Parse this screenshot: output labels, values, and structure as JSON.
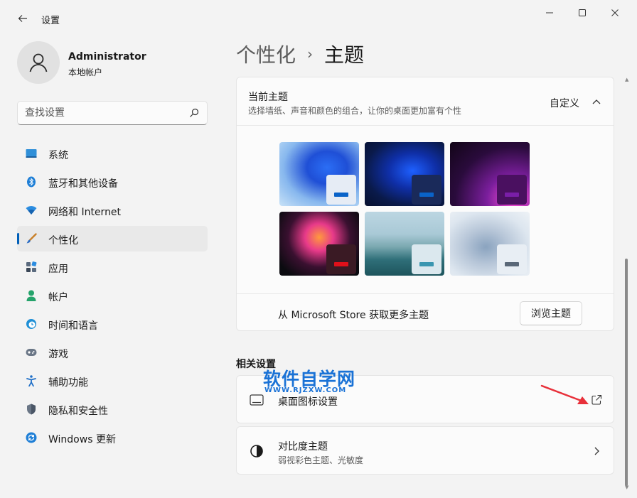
{
  "window": {
    "title": "设置",
    "back_icon": "back-arrow-icon",
    "controls": [
      "minimize-icon",
      "maximize-icon",
      "close-icon"
    ]
  },
  "profile": {
    "name": "Administrator",
    "account_type": "本地帐户"
  },
  "search": {
    "placeholder": "查找设置",
    "value": ""
  },
  "sidebar": {
    "items": [
      {
        "label": "系统",
        "icon": "system-icon",
        "active": false
      },
      {
        "label": "蓝牙和其他设备",
        "icon": "bluetooth-icon",
        "active": false
      },
      {
        "label": "网络和 Internet",
        "icon": "network-icon",
        "active": false
      },
      {
        "label": "个性化",
        "icon": "personalization-icon",
        "active": true
      },
      {
        "label": "应用",
        "icon": "apps-icon",
        "active": false
      },
      {
        "label": "帐户",
        "icon": "account-icon",
        "active": false
      },
      {
        "label": "时间和语言",
        "icon": "time-language-icon",
        "active": false
      },
      {
        "label": "游戏",
        "icon": "gaming-icon",
        "active": false
      },
      {
        "label": "辅助功能",
        "icon": "accessibility-icon",
        "active": false
      },
      {
        "label": "隐私和安全性",
        "icon": "privacy-icon",
        "active": false
      },
      {
        "label": "Windows 更新",
        "icon": "windows-update-icon",
        "active": false
      }
    ]
  },
  "breadcrumb": {
    "parent": "个性化",
    "separator": "›",
    "current": "主题"
  },
  "current_theme": {
    "title": "当前主题",
    "description": "选择墙纸、声音和颜色的组合，让你的桌面更加富有个性",
    "selected": "自定义",
    "expanded": true,
    "thumbnails": [
      {
        "name": "theme-windows-light",
        "accent": "#0a63c9",
        "tile": "#e6ecf5"
      },
      {
        "name": "theme-windows-dark",
        "accent": "#0a63c9",
        "tile": "#1a2a5a"
      },
      {
        "name": "theme-glow",
        "accent": "#7a1ea8",
        "tile": "#4a1060"
      },
      {
        "name": "theme-captured-motion",
        "accent": "#e0101a",
        "tile": "#3a1a24"
      },
      {
        "name": "theme-sunrise",
        "accent": "#3a96b0",
        "tile": "#dbe8ee"
      },
      {
        "name": "theme-flow",
        "accent": "#5a6878",
        "tile": "#e8eef4"
      }
    ],
    "store_label": "从 Microsoft Store 获取更多主题",
    "browse_label": "浏览主题"
  },
  "related": {
    "title": "相关设置",
    "desktop_icons": "桌面图标设置",
    "contrast_title": "对比度主题",
    "contrast_desc": "弱视彩色主题、光敏度"
  },
  "watermark": {
    "main": "软件自学网",
    "sub": "WWW.RJZXW.COM"
  },
  "colors": {
    "accent": "#005fb8",
    "watermark": "#1a72d6",
    "arrow": "#e8303a"
  }
}
